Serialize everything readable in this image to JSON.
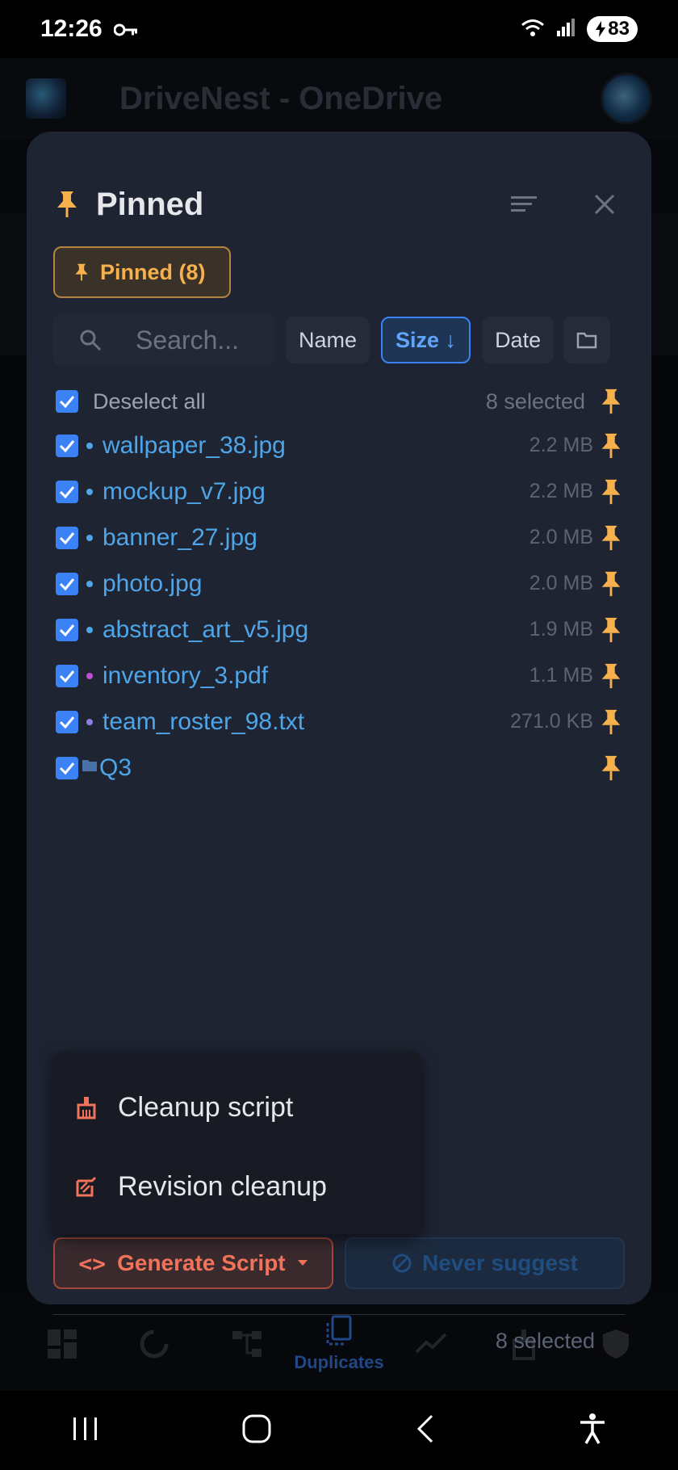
{
  "status_bar": {
    "time": "12:26",
    "battery": "83"
  },
  "app": {
    "title": "DriveNest - OneDrive"
  },
  "sheet": {
    "title": "Pinned",
    "chip_label": "Pinned (8)",
    "search_placeholder": "Search...",
    "sort_options": [
      "Name",
      "Size ↓",
      "Date"
    ],
    "active_sort": "Size ↓",
    "deselect_label": "Deselect all",
    "selected_count": "8 selected",
    "files": [
      {
        "name": "wallpaper_38.jpg",
        "size": "2.2 MB",
        "dot_color": "#4ea5e8",
        "checked": true
      },
      {
        "name": "mockup_v7.jpg",
        "size": "2.2 MB",
        "dot_color": "#4ea5e8",
        "checked": true
      },
      {
        "name": "banner_27.jpg",
        "size": "2.0 MB",
        "dot_color": "#4ea5e8",
        "checked": true
      },
      {
        "name": "photo.jpg",
        "size": "2.0 MB",
        "dot_color": "#4ea5e8",
        "checked": true
      },
      {
        "name": "abstract_art_v5.jpg",
        "size": "1.9 MB",
        "dot_color": "#4ea5e8",
        "checked": true
      },
      {
        "name": "inventory_3.pdf",
        "size": "1.1 MB",
        "dot_color": "#c04fd6",
        "checked": true
      },
      {
        "name": "team_roster_98.txt",
        "size": "271.0 KB",
        "dot_color": "#8b7fe0",
        "checked": true
      },
      {
        "name": "Q3",
        "size": "",
        "dot_color": "",
        "checked": true,
        "is_folder": true
      }
    ]
  },
  "menu": {
    "items": [
      {
        "label": "Cleanup script",
        "icon": "broom-icon"
      },
      {
        "label": "Revision cleanup",
        "icon": "revision-cleanup-icon"
      }
    ]
  },
  "footer": {
    "selected_count": "8 selected",
    "generate_label": "Generate Script",
    "never_label": "Never suggest"
  },
  "bottom_nav": {
    "active_label": "Duplicates"
  },
  "colors": {
    "accent_blue": "#3b82f6",
    "pin_orange": "#f6b04c",
    "danger": "#f0735a"
  }
}
